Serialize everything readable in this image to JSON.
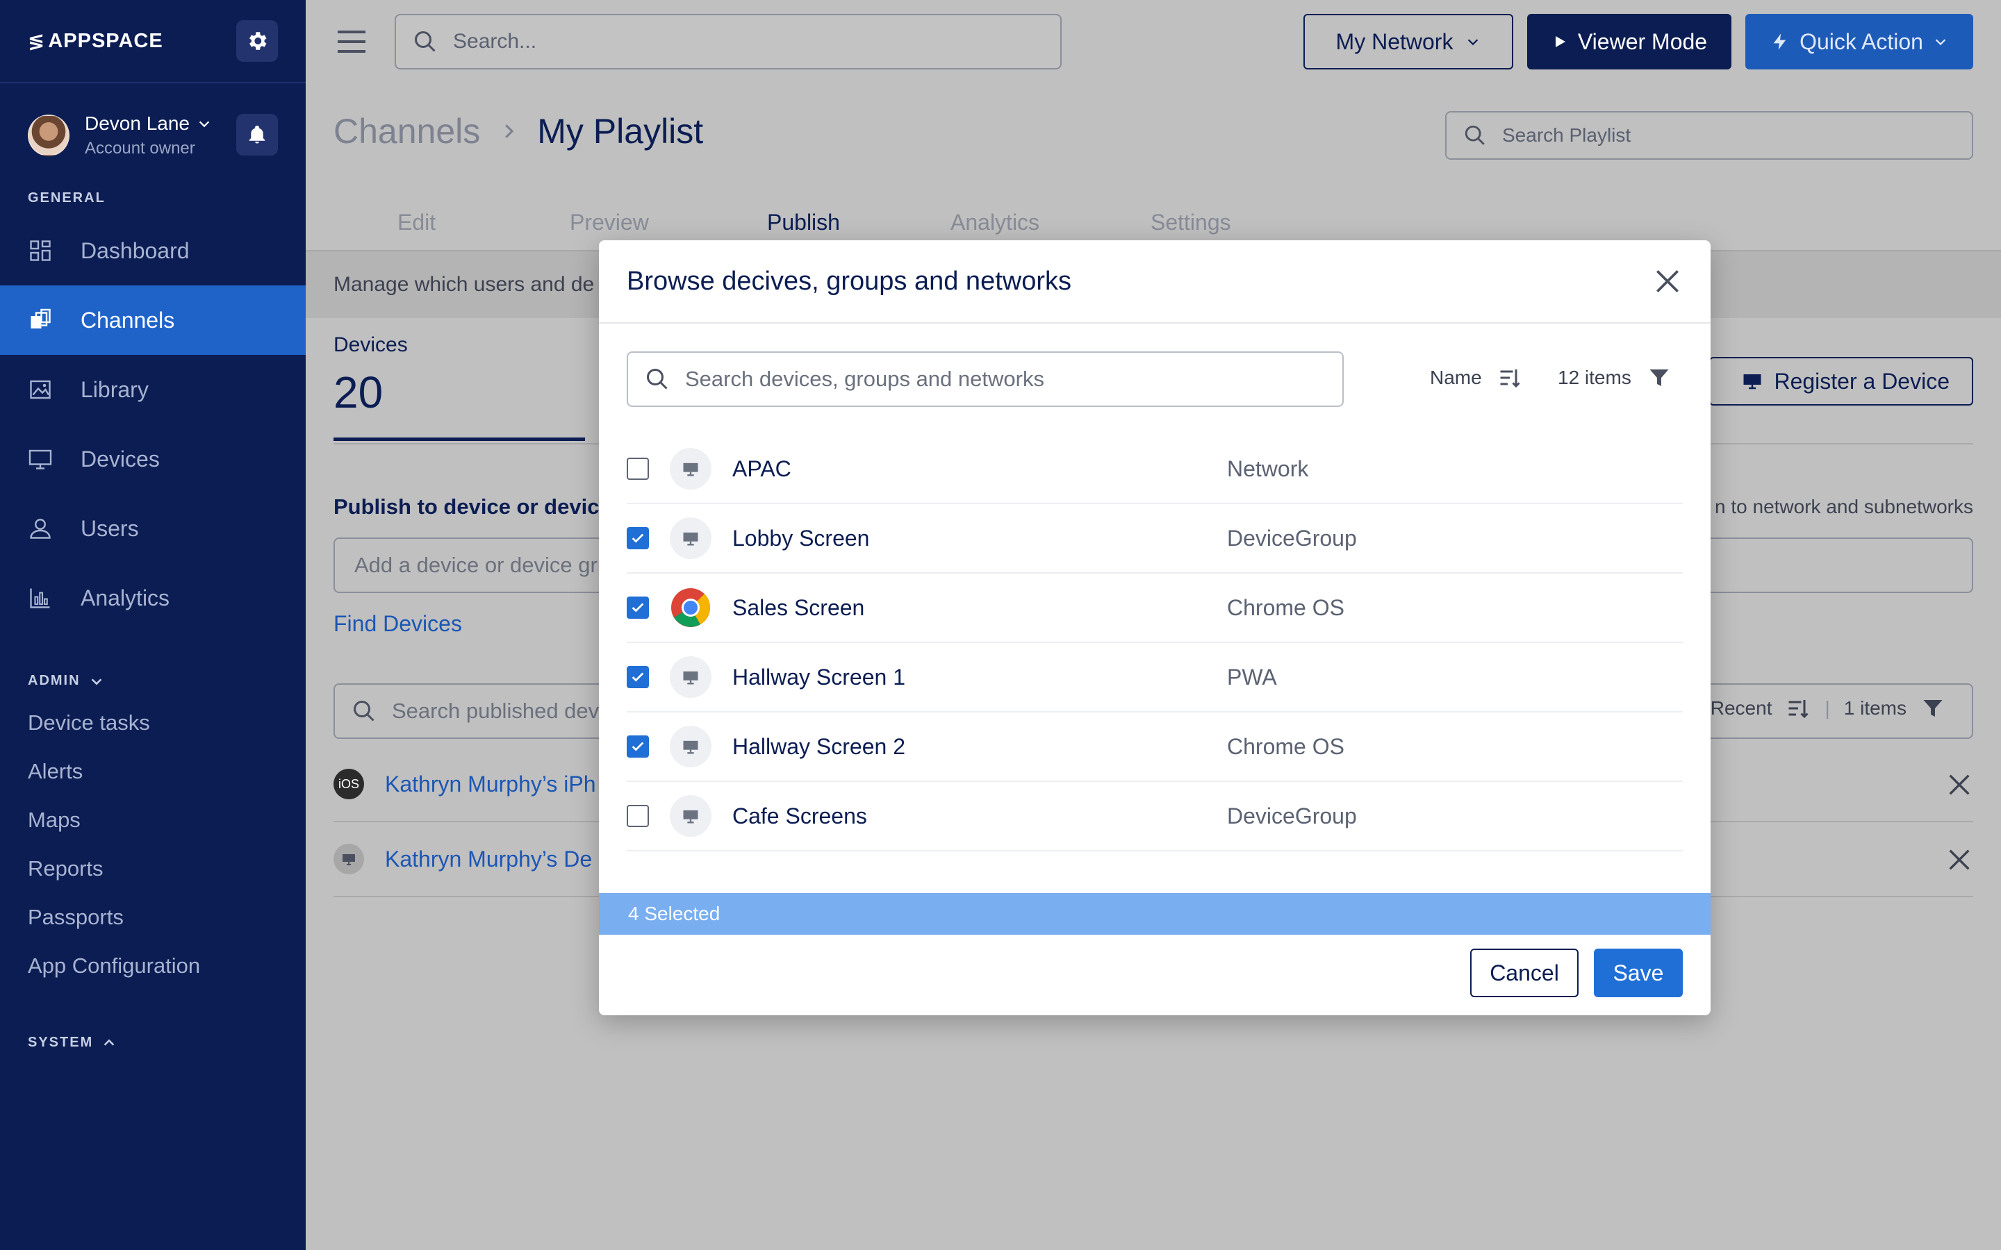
{
  "brand": {
    "logo_text": "APPSPACE"
  },
  "user": {
    "name": "Devon Lane",
    "role": "Account owner"
  },
  "sidebar": {
    "general_label": "GENERAL",
    "items": [
      {
        "label": "Dashboard",
        "icon": "dashboard-icon"
      },
      {
        "label": "Channels",
        "icon": "channels-icon",
        "active": true
      },
      {
        "label": "Library",
        "icon": "library-icon"
      },
      {
        "label": "Devices",
        "icon": "devices-icon"
      },
      {
        "label": "Users",
        "icon": "users-icon"
      },
      {
        "label": "Analytics",
        "icon": "analytics-icon"
      }
    ],
    "admin_label": "ADMIN",
    "admin_items": [
      "Device tasks",
      "Alerts",
      "Maps",
      "Reports",
      "Passports",
      "App Configuration"
    ],
    "system_label": "SYSTEM"
  },
  "topbar": {
    "search_placeholder": "Search...",
    "network_label": "My Network",
    "viewer_label": "Viewer Mode",
    "quick_action_label": "Quick Action"
  },
  "page": {
    "breadcrumb_parent": "Channels",
    "breadcrumb_current": "My Playlist",
    "playlist_search_placeholder": "Search Playlist",
    "tabs": [
      "Edit",
      "Preview",
      "Publish",
      "Analytics",
      "Settings"
    ],
    "active_tab": "Publish",
    "info_text": "Manage which users and de",
    "devices_label": "Devices",
    "devices_count": "20",
    "register_label": "Register a Device",
    "publish_label": "Publish to device or device",
    "publish_hint": "n to network and subnetworks",
    "add_device_placeholder": "Add a device or device gr",
    "find_devices": "Find Devices",
    "published_search_placeholder": "Search published dev",
    "published_sort": "Recent",
    "published_count": "1 items",
    "published_rows": [
      {
        "name": "Kathryn Murphy’s iPh",
        "icon": "ios-icon",
        "badge": "iOS"
      },
      {
        "name": "Kathryn Murphy’s De",
        "icon": "monitor-icon"
      }
    ]
  },
  "modal": {
    "title": "Browse decives, groups and networks",
    "search_placeholder": "Search devices, groups and networks",
    "sort_label": "Name",
    "count_label": "12 items",
    "rows": [
      {
        "name": "APAC",
        "type": "Network",
        "checked": false,
        "icon": "monitor-icon"
      },
      {
        "name": "Lobby Screen",
        "type": "DeviceGroup",
        "checked": true,
        "icon": "monitor-icon"
      },
      {
        "name": "Sales Screen",
        "type": "Chrome OS",
        "checked": true,
        "icon": "chrome-icon"
      },
      {
        "name": "Hallway Screen 1",
        "type": "PWA",
        "checked": true,
        "icon": "monitor-icon"
      },
      {
        "name": "Hallway Screen 2",
        "type": "Chrome OS",
        "checked": true,
        "icon": "monitor-icon"
      },
      {
        "name": "Cafe Screens",
        "type": "DeviceGroup",
        "checked": false,
        "icon": "monitor-icon"
      }
    ],
    "selected_text": "4 Selected",
    "cancel_label": "Cancel",
    "save_label": "Save"
  },
  "colors": {
    "sidebar_bg": "#0b1d52",
    "active_nav": "#1f63c9",
    "primary": "#1f6fd6",
    "selected_bar": "#79aef0",
    "overlay_bg": "#c0c0c0"
  }
}
